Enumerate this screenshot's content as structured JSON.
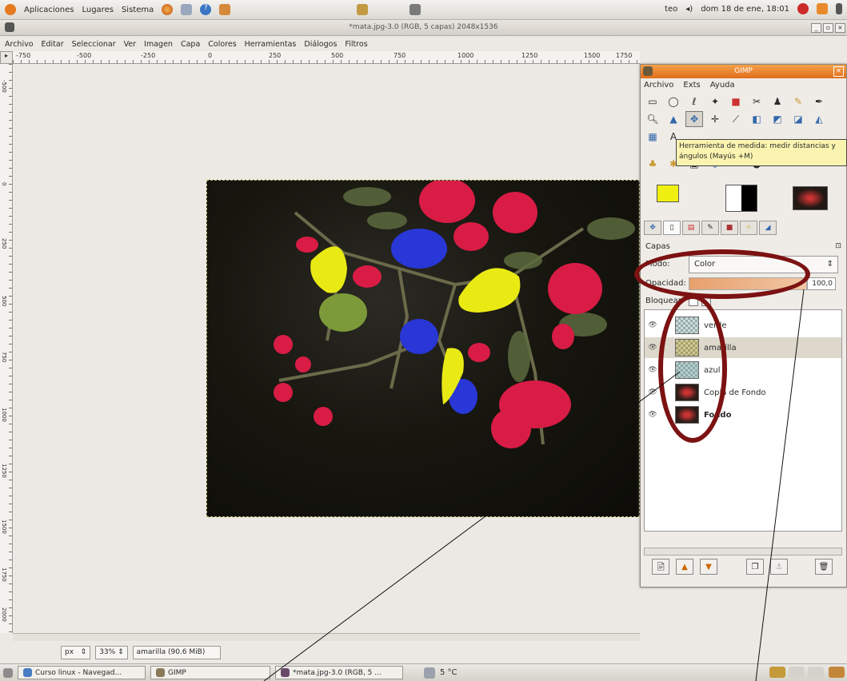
{
  "panel": {
    "menus": [
      "Aplicaciones",
      "Lugares",
      "Sistema"
    ],
    "user": "teo",
    "clock": "dom 18 de ene, 18:01"
  },
  "window": {
    "title": "*mata.jpg-3.0 (RGB, 5 capas) 2048x1536"
  },
  "menubar": [
    "Archivo",
    "Editar",
    "Seleccionar",
    "Ver",
    "Imagen",
    "Capa",
    "Colores",
    "Herramientas",
    "Diálogos",
    "Filtros"
  ],
  "ruler": {
    "h_ticks": [
      "-750",
      "-500",
      "-250",
      "0",
      "250",
      "500",
      "750",
      "1000",
      "1250",
      "1500",
      "1750"
    ],
    "v_ticks": [
      "-500",
      "0",
      "250",
      "500",
      "750",
      "1000",
      "1250",
      "1500",
      "1750",
      "2000"
    ]
  },
  "statusbar": {
    "unit": "px",
    "zoom": "33%",
    "info": "amarilla (90.6 MiB)"
  },
  "taskbar": {
    "tasks": [
      "Curso linux - Navegad...",
      "GIMP",
      "*mata.jpg-3.0 (RGB, 5 ...",
      "5 °C"
    ]
  },
  "toolbox": {
    "title": "GIMP",
    "menu": [
      "Archivo",
      "Exts",
      "Ayuda"
    ],
    "tooltip": "Herramienta de medida: medir distancias y ángulos  (Mayús +M)"
  },
  "layers_dialog": {
    "section_label": "Capas",
    "mode_label": "Modo:",
    "mode_value": "Color",
    "opacity_label": "Opacidad:",
    "opacity_value": "100,0",
    "lock_label": "Bloquear:",
    "layers": [
      {
        "name": "verde",
        "selected": false
      },
      {
        "name": "amarilla",
        "selected": true
      },
      {
        "name": "azul",
        "selected": false
      },
      {
        "name": "Copia de Fondo",
        "selected": false
      },
      {
        "name": "Fondo",
        "selected": false
      }
    ]
  },
  "colors": {
    "fg": "#f0f010",
    "bg": "#ffffff",
    "annotation": "#7c1212",
    "gimp_title": "#e8802e"
  }
}
